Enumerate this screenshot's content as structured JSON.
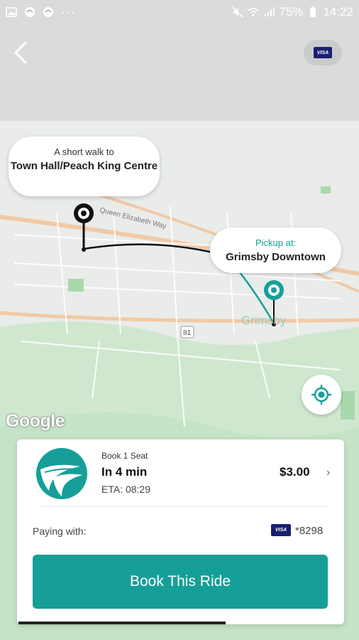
{
  "status_bar": {
    "battery": "75%",
    "time": "14:22",
    "dots": "···"
  },
  "map": {
    "road_label_highway": "Queen Elizabeth Way",
    "road_label_shield": "81",
    "place_label": "Grimsby",
    "attribution": "Google"
  },
  "walk_callout": {
    "subtitle": "A short walk to",
    "title": "Town Hall/Peach King Centre"
  },
  "pickup_callout": {
    "subtitle": "Pickup at:",
    "title": "Grimsby Downtown"
  },
  "icons": {
    "back": "chevron-left-icon",
    "card": "visa-card-icon",
    "locate": "my-location-icon",
    "ride": "ride-logo-icon"
  },
  "ride": {
    "label": "Book 1 Seat",
    "time": "In 4 min",
    "eta": "ETA: 08:29",
    "price": "$3.00",
    "chevron": "›"
  },
  "payment": {
    "label": "Paying with:",
    "card_brand": "VISA",
    "last4": "*8298"
  },
  "book_button": {
    "label": "Book This Ride"
  },
  "colors": {
    "accent": "#169f98",
    "visa": "#1a1f71",
    "map_bg": "#e9ece9",
    "map_green": "#c8e6c9",
    "road_orange": "#f0c8a0"
  }
}
